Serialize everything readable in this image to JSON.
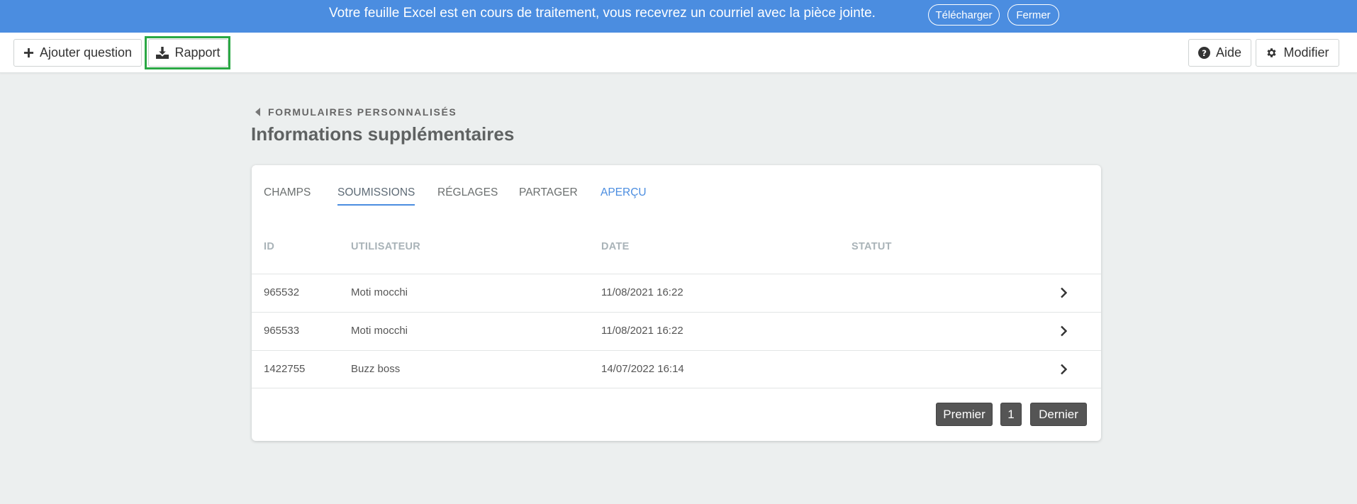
{
  "banner": {
    "message": "Votre feuille Excel est en cours de traitement, vous recevrez un courriel avec la pièce jointe.",
    "download_label": "Télécharger",
    "close_label": "Fermer",
    "color": "#4b8de0"
  },
  "toolbar": {
    "add_question_label": "Ajouter question",
    "report_label": "Rapport",
    "help_label": "Aide",
    "edit_label": "Modifier"
  },
  "breadcrumb": {
    "label": "FORMULAIRES PERSONNALISÉS"
  },
  "page_title": "Informations supplémentaires",
  "tabs": [
    {
      "label": "CHAMPS"
    },
    {
      "label": "SOUMISSIONS",
      "active": true
    },
    {
      "label": "RÉGLAGES"
    },
    {
      "label": "PARTAGER"
    },
    {
      "label": "APERÇU"
    }
  ],
  "table": {
    "headers": [
      "ID",
      "UTILISATEUR",
      "DATE",
      "STATUT"
    ],
    "rows": [
      {
        "id": "965532",
        "user": "Moti mocchi",
        "date": "11/08/2021 16:22",
        "status": ""
      },
      {
        "id": "965533",
        "user": "Moti mocchi",
        "date": "11/08/2021 16:22",
        "status": ""
      },
      {
        "id": "1422755",
        "user": "Buzz boss",
        "date": "14/07/2022 16:14",
        "status": ""
      }
    ]
  },
  "pagination": {
    "first_label": "Premier",
    "page": "1",
    "last_label": "Dernier"
  },
  "colors": {
    "accent": "#4b8de0",
    "highlight": "#2aa844"
  }
}
